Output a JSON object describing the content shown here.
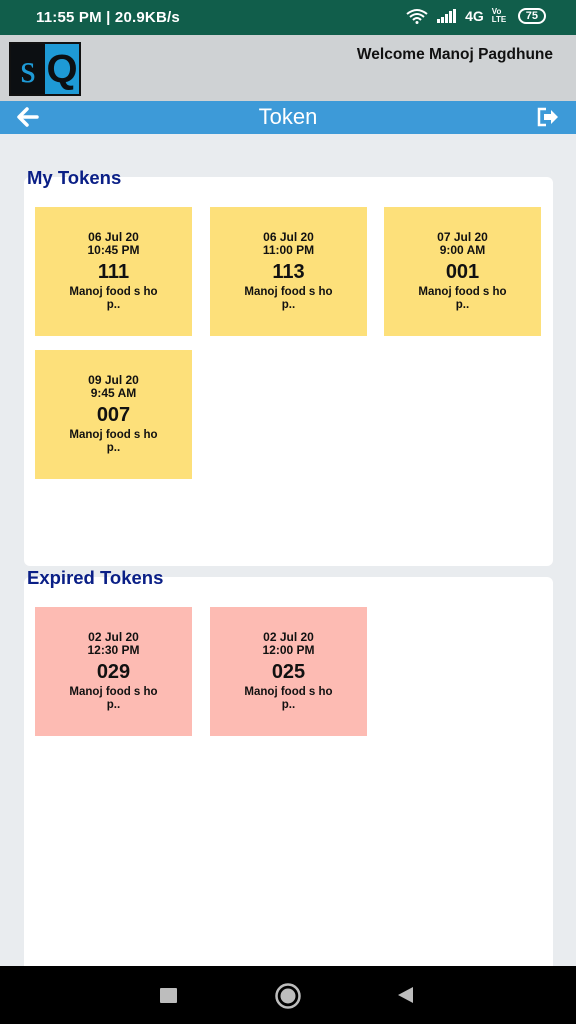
{
  "status_bar": {
    "time": "11:55 PM | 20.9KB/s",
    "network": "4G",
    "volte": "Vo LTE",
    "battery": "75"
  },
  "header": {
    "logo_text": [
      "s",
      "Q"
    ],
    "welcome": "Welcome Manoj Pagdhune"
  },
  "toolbar": {
    "title": "Token",
    "back_icon": "arrow-left-icon",
    "exit_icon": "sign-out-icon"
  },
  "my_tokens": {
    "title": "My Tokens",
    "tokens": [
      {
        "date": "06 Jul 20",
        "time": "10:45 PM",
        "number": "111",
        "shop": "Manoj food s hop.."
      },
      {
        "date": "06 Jul 20",
        "time": "11:00 PM",
        "number": "113",
        "shop": "Manoj food s hop.."
      },
      {
        "date": "07 Jul 20",
        "time": "9:00 AM",
        "number": "001",
        "shop": "Manoj food s hop.."
      },
      {
        "date": "09 Jul 20",
        "time": "9:45 AM",
        "number": "007",
        "shop": "Manoj food s hop.."
      }
    ]
  },
  "expired_tokens": {
    "title": "Expired Tokens",
    "tokens": [
      {
        "date": "02 Jul 20",
        "time": "12:30 PM",
        "number": "029",
        "shop": "Manoj food s hop.."
      },
      {
        "date": "02 Jul 20",
        "time": "12:00 PM",
        "number": "025",
        "shop": "Manoj food s hop.."
      }
    ]
  },
  "colors": {
    "active_token": "#fde07a",
    "expired_token": "#fdbbb3",
    "toolbar": "#3d9ad8",
    "status_bar": "#115e4b",
    "section_title": "#0a1f86"
  }
}
